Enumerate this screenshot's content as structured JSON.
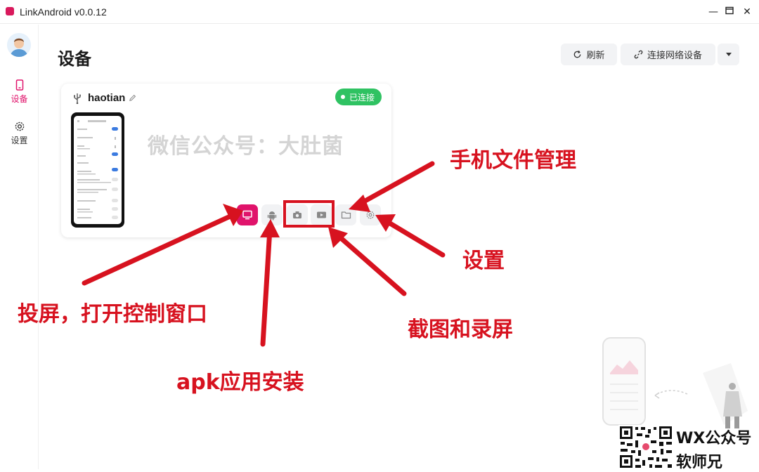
{
  "window": {
    "title": "LinkAndroid v0.0.12",
    "controls": {
      "minimize": "—",
      "maximize": "▢",
      "close": "✕"
    }
  },
  "sidebar": {
    "items": [
      {
        "label": "设备",
        "icon": "phone-icon",
        "active": true
      },
      {
        "label": "设置",
        "icon": "gear-icon",
        "active": false
      }
    ]
  },
  "main": {
    "title": "设备",
    "toolbar": {
      "refresh_label": "刷新",
      "connect_network_label": "连接网络设备",
      "dropdown_icon": "caret-down-icon"
    }
  },
  "device": {
    "name": "haotian",
    "status": "已连接",
    "connection_icon": "usb-icon",
    "actions": [
      "screen-mirror-icon",
      "android-icon",
      "camera-icon",
      "record-icon",
      "folder-icon",
      "gear-icon"
    ]
  },
  "watermark": "微信公众号：大肚菌",
  "annotations": {
    "file_manager": "手机文件管理",
    "settings": "设置",
    "mirror": "投屏，打开控制窗口",
    "screenshot_record": "截图和录屏",
    "apk_install": "apk应用安装"
  },
  "footer_badge": {
    "line1": "WX公众号",
    "line2": "软师兄"
  },
  "colors": {
    "accent": "#e0136b",
    "status_green": "#2fc262",
    "annotation_red": "#d7121f"
  }
}
